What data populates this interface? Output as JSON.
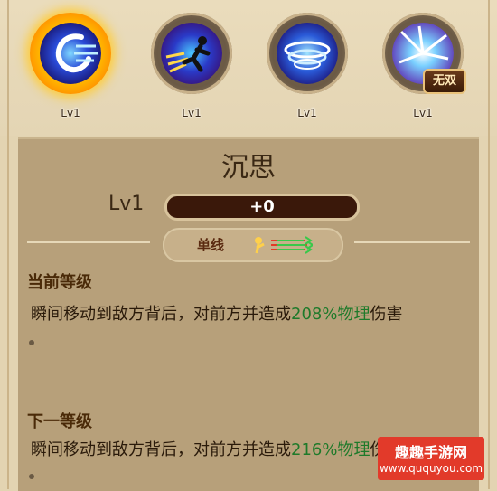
{
  "skills": [
    {
      "level": "Lv1",
      "icon": "swirl-slash-icon",
      "selected": true
    },
    {
      "level": "Lv1",
      "icon": "dash-runner-icon",
      "selected": false
    },
    {
      "level": "Lv1",
      "icon": "whirlwind-ring-icon",
      "selected": false
    },
    {
      "level": "Lv1",
      "icon": "lightning-burst-icon",
      "selected": false,
      "badge": "无双"
    }
  ],
  "detail": {
    "name": "沉思",
    "level": "Lv1",
    "exp_text": "+0",
    "target_type": "单线",
    "current_heading": "当前等级",
    "current_desc_pre": "瞬间移动到敌方背后，对前方并造成",
    "current_desc_value": "208%物理",
    "current_desc_post": "伤害",
    "next_heading": "下一等级",
    "next_desc_pre": "瞬间移动到敌方背后，对前方并造成",
    "next_desc_value": "216%物理",
    "next_desc_post": "伤害"
  },
  "watermark": {
    "cn": "趣趣手游网",
    "en": "www.ququyou.com"
  },
  "colors": {
    "background": "#e3d4b2",
    "panel": "#b7a07a",
    "highlight_green": "#1e7a2a",
    "selected_glow": "#ffb300",
    "watermark_red": "#e23a2a"
  }
}
